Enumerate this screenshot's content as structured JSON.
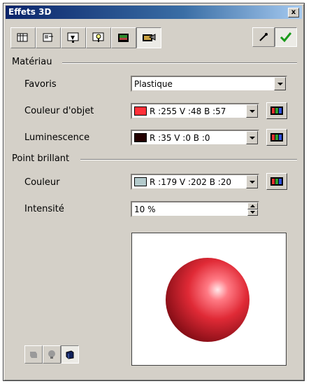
{
  "window": {
    "title": "Effets 3D",
    "close_glyph": "x"
  },
  "toolbar": {
    "tabs": [
      {
        "icon": "geometry-icon"
      },
      {
        "icon": "shading-icon"
      },
      {
        "icon": "illumination-icon"
      },
      {
        "icon": "light-bulb-icon"
      },
      {
        "icon": "textures-icon"
      },
      {
        "icon": "material-icon",
        "active": true
      }
    ],
    "assign_icon": "pipette-icon",
    "apply_icon": "checkmark-icon"
  },
  "material": {
    "section_label": "Matériau",
    "favorites": {
      "label": "Favoris",
      "value": "Plastique"
    },
    "object_color": {
      "label": "Couleur d'objet",
      "value": "R :255 V :48 B :57",
      "color": "#ff3039"
    },
    "luminescence": {
      "label": "Luminescence",
      "value": "R :35 V :0 B :0",
      "color": "#230000"
    }
  },
  "highlight": {
    "section_label": "Point brillant",
    "color": {
      "label": "Couleur",
      "value": "R :179 V :202 B :20",
      "color": "#b3cacc"
    },
    "intensity": {
      "label": "Intensité",
      "value": "10 %"
    }
  },
  "preview": {
    "sphere_color": "#e02a36"
  },
  "bottom_tools": [
    {
      "icon": "cube-flat-icon"
    },
    {
      "icon": "light-toggle-icon"
    },
    {
      "icon": "cube-3d-icon",
      "active": true
    }
  ]
}
